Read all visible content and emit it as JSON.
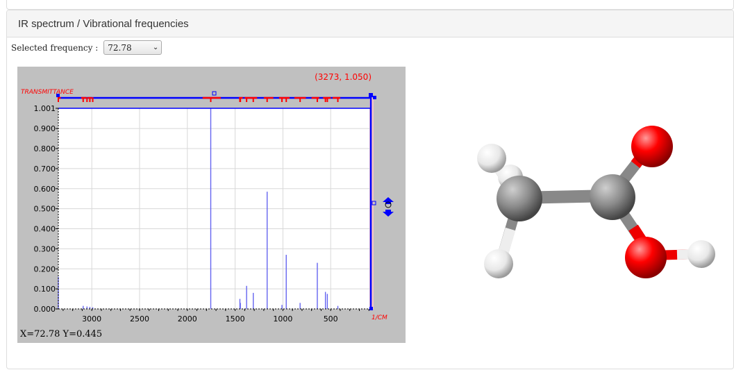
{
  "panel": {
    "title": "IR spectrum / Vibrational frequencies"
  },
  "selector": {
    "label": "Selected frequency :",
    "value": "72.78"
  },
  "spectrum": {
    "coord_label": "(3273, 1.050)",
    "y_axis_title": "TRANSMITTANCE",
    "x_unit": "1/CM",
    "readout": "X=72.78 Y=0.445",
    "colors": {
      "axis": "#0000ff",
      "peaks": "#6464f0",
      "marker": "#ff0000",
      "background": "#c0c0c0"
    }
  },
  "chart_data": {
    "type": "bar",
    "x_ticks": [
      "3000",
      "2500",
      "2000",
      "1500",
      "1000",
      "500"
    ],
    "y_ticks": [
      "1.001",
      "0.900",
      "0.800",
      "0.700",
      "0.600",
      "0.500",
      "0.400",
      "0.300",
      "0.200",
      "0.100",
      "0.000"
    ],
    "xlim": [
      3350,
      80
    ],
    "ylim": [
      0,
      1.001
    ],
    "x_reversed": true,
    "grid": true,
    "peaks": [
      {
        "x": 3350,
        "y": 0.16
      },
      {
        "x": 3090,
        "y": 0.015
      },
      {
        "x": 3050,
        "y": 0.012
      },
      {
        "x": 3020,
        "y": 0.01
      },
      {
        "x": 2990,
        "y": 0.008
      },
      {
        "x": 1755,
        "y": 1.0
      },
      {
        "x": 1450,
        "y": 0.05
      },
      {
        "x": 1445,
        "y": 0.03
      },
      {
        "x": 1380,
        "y": 0.115
      },
      {
        "x": 1310,
        "y": 0.08
      },
      {
        "x": 1165,
        "y": 0.585
      },
      {
        "x": 1010,
        "y": 0.02
      },
      {
        "x": 965,
        "y": 0.27
      },
      {
        "x": 820,
        "y": 0.03
      },
      {
        "x": 640,
        "y": 0.23
      },
      {
        "x": 555,
        "y": 0.085
      },
      {
        "x": 535,
        "y": 0.075
      },
      {
        "x": 425,
        "y": 0.015
      }
    ],
    "selected_frequency": 72.78
  },
  "molecule": {
    "atoms": [
      "C",
      "C",
      "O",
      "O",
      "H",
      "H",
      "H",
      "H"
    ],
    "colors": {
      "carbon": "#8a8a8a",
      "oxygen": "#ff0000",
      "hydrogen": "#f2f2f2"
    }
  }
}
